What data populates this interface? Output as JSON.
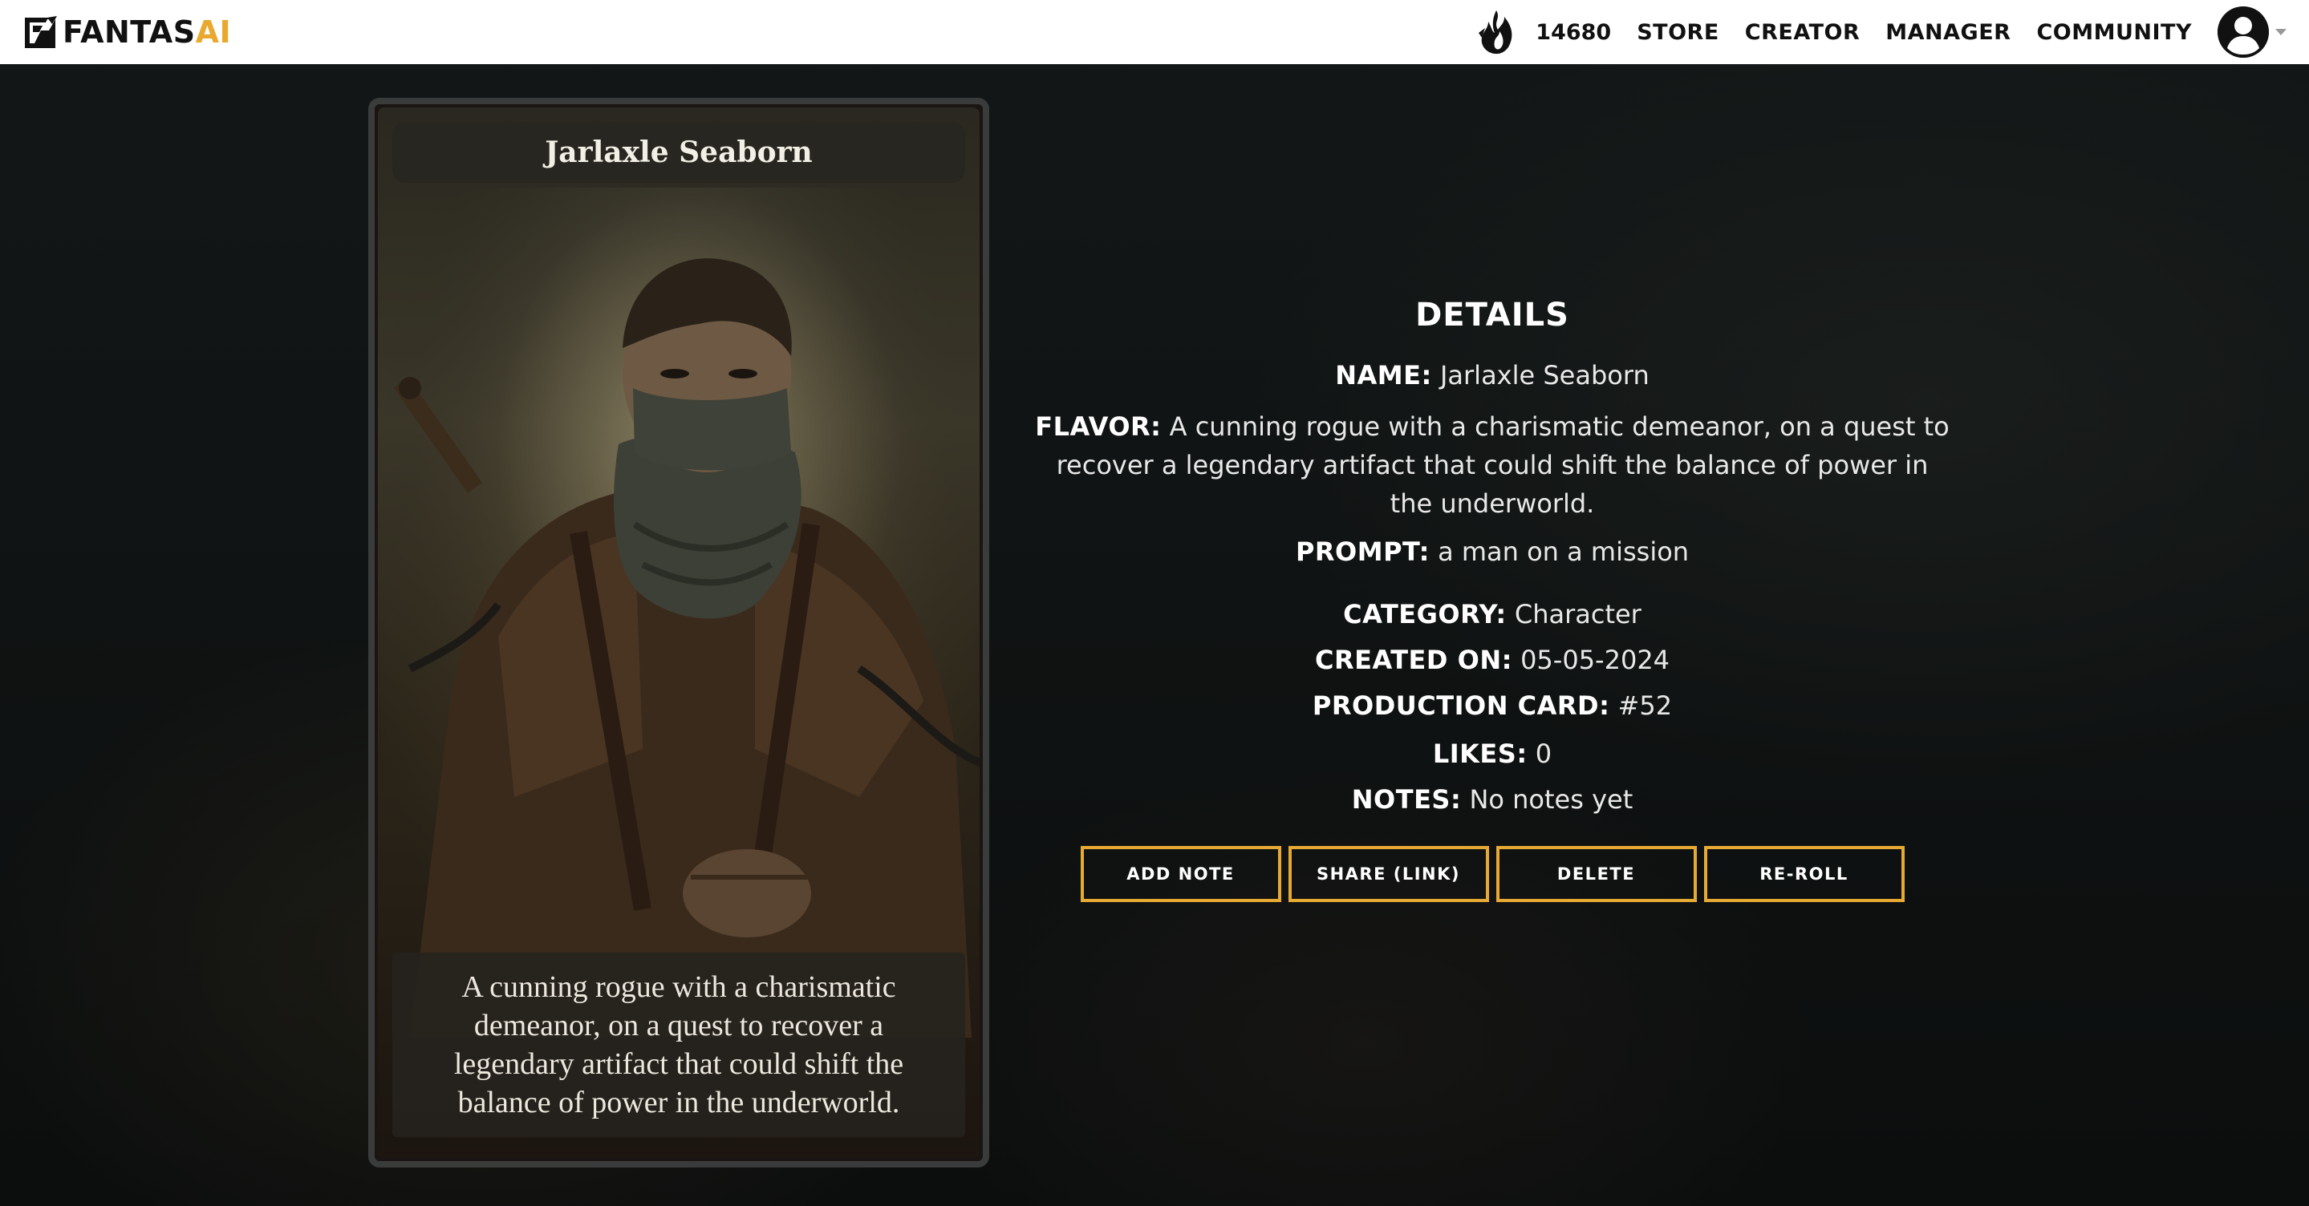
{
  "header": {
    "logo_text_main": "FANTAS",
    "logo_text_accent": "AI",
    "coins": "14680",
    "coin_icon": "flame-icon",
    "nav": [
      "STORE",
      "CREATOR",
      "MANAGER",
      "COMMUNITY"
    ],
    "accent_color": "#e8a92e"
  },
  "card": {
    "title": "Jarlaxle Seaborn",
    "flavor": "A cunning rogue with a charismatic demeanor, on a quest to recover a legendary artifact that could shift the balance of power in the underworld."
  },
  "details": {
    "title": "DETAILS",
    "name_label": "NAME:",
    "name": "Jarlaxle Seaborn",
    "flavor_label": "FLAVOR:",
    "flavor": "A cunning rogue with a charismatic demeanor, on a quest to recover a legendary artifact that could shift the balance of power in the underworld.",
    "prompt_label": "PROMPT:",
    "prompt": "a man on a mission",
    "category_label": "CATEGORY:",
    "category": "Character",
    "created_label": "CREATED ON:",
    "created": "05-05-2024",
    "production_label": "PRODUCTION CARD:",
    "production": "#52",
    "likes_label": "LIKES:",
    "likes": "0",
    "notes_label": "NOTES:",
    "notes": "No notes yet"
  },
  "actions": {
    "add_note": "ADD NOTE",
    "share": "SHARE (LINK)",
    "delete": "DELETE",
    "reroll": "RE-ROLL",
    "border_color": "#e6a934"
  }
}
